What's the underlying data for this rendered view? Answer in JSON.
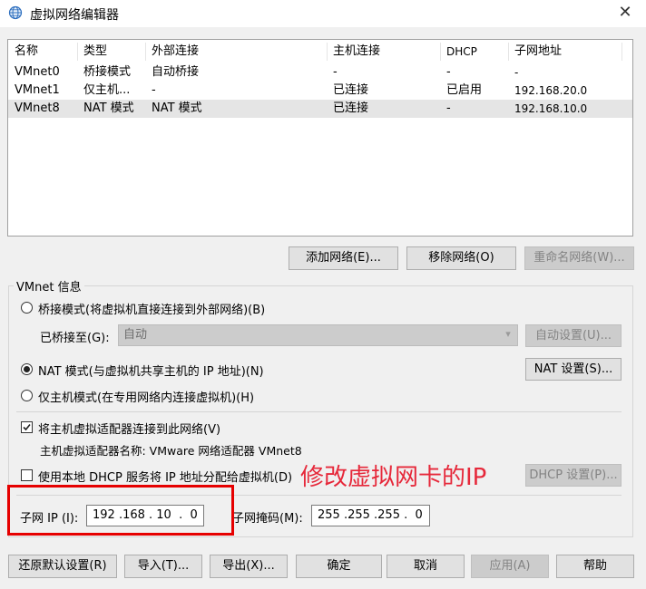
{
  "window": {
    "title": "虚拟网络编辑器",
    "close_symbol": "✕"
  },
  "table": {
    "headers": [
      "名称",
      "类型",
      "外部连接",
      "主机连接",
      "DHCP",
      "子网地址"
    ],
    "rows": [
      [
        "VMnet0",
        "桥接模式",
        "自动桥接",
        "-",
        "-",
        "-"
      ],
      [
        "VMnet1",
        "仅主机...",
        "-",
        "已连接",
        "已启用",
        "192.168.20.0"
      ],
      [
        "VMnet8",
        "NAT 模式",
        "NAT 模式",
        "已连接",
        "-",
        "192.168.10.0"
      ]
    ],
    "selected_row": "VMnet8"
  },
  "list_buttons": {
    "add": "添加网络(E)...",
    "remove": "移除网络(O)",
    "rename": "重命名网络(W)..."
  },
  "vmnet_info": {
    "legend": "VMnet 信息",
    "bridged_label": "桥接模式(将虚拟机直接连接到外部网络)(B)",
    "bridged_to_label": "已桥接至(G):",
    "bridged_to_value": "自动",
    "auto_settings": "自动设置(U)...",
    "nat_label": "NAT 模式(与虚拟机共享主机的 IP 地址)(N)",
    "nat_settings": "NAT 设置(S)...",
    "hostonly_label": "仅主机模式(在专用网络内连接虚拟机)(H)",
    "connect_adapter_label": "将主机虚拟适配器连接到此网络(V)",
    "adapter_name": "主机虚拟适配器名称: VMware 网络适配器 VMnet8",
    "dhcp_label": "使用本地 DHCP 服务将 IP 地址分配给虚拟机(D)",
    "dhcp_settings": "DHCP 设置(P)...",
    "selected_mode": "NAT",
    "connect_adapter_checked": true,
    "dhcp_checked": false
  },
  "subnet": {
    "ip_label": "子网 IP (I):",
    "ip_value": "192 .168 . 10  .  0",
    "mask_label": "子网掩码(M):",
    "mask_value": "255 .255 .255 .  0"
  },
  "annotation": {
    "text": "修改虚拟网卡的IP",
    "color": "#e6283a"
  },
  "footer_buttons": {
    "restore": "还原默认设置(R)",
    "import": "导入(T)...",
    "export": "导出(X)...",
    "ok": "确定",
    "cancel": "取消",
    "apply": "应用(A)",
    "help": "帮助"
  }
}
